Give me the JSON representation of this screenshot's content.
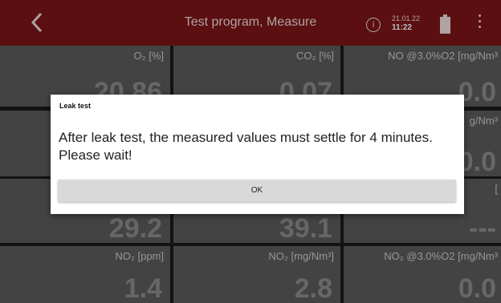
{
  "header": {
    "title": "Test program, Measure",
    "info_icon_glyph": "i",
    "date": "21.01.22",
    "time": "11:22",
    "color": "#7a1416"
  },
  "cells": [
    {
      "label": "O₂ [%]",
      "value": "20.86"
    },
    {
      "label": "CO₂ [%]",
      "value": "0.07"
    },
    {
      "label": "NO @3.0%O2 [mg/Nm³",
      "value": "0.0"
    },
    {
      "label": "",
      "value": ""
    },
    {
      "label": "",
      "value": ""
    },
    {
      "label": "g/Nm³",
      "value": "0.0"
    },
    {
      "label": "",
      "value": "29.2"
    },
    {
      "label": "",
      "value": "39.1"
    },
    {
      "label": "[",
      "value": "---"
    },
    {
      "label": "NO₂ [ppm]",
      "value": "1.4"
    },
    {
      "label": "NO₂ [mg/Nm³]",
      "value": "2.8"
    },
    {
      "label": "NO₂ @3.0%O2 [mg/Nm³",
      "value": "0.0"
    }
  ],
  "dialog": {
    "title": "Leak test",
    "message": "After leak test, the measured values must settle for 4 minutes. Please wait!",
    "ok_label": "OK"
  }
}
